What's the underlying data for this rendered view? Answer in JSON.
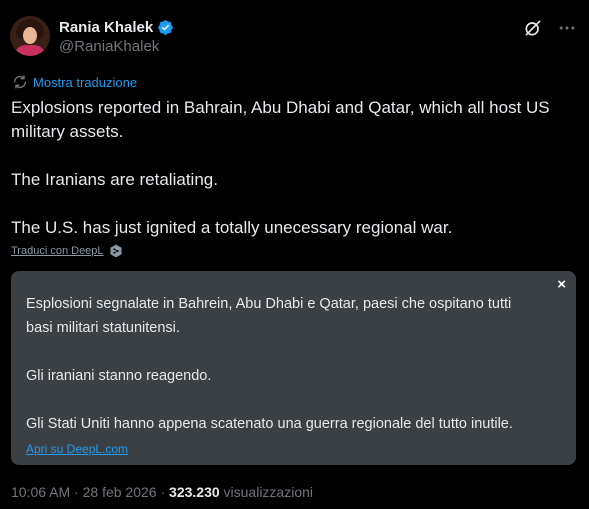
{
  "author": {
    "display_name": "Rania Khalek",
    "handle": "@RaniaKhalek",
    "verified": true,
    "verified_color": "#1d9bf0"
  },
  "translate": {
    "show_translation": "Mostra traduzione",
    "translate_with": "Traduci con DeepL"
  },
  "tweet": {
    "paragraphs": [
      "Explosions reported in Bahrain, Abu Dhabi and Qatar, which all host US military assets.",
      "The Iranians are retaliating.",
      "The U.S. has just ignited a totally unecessary regional war."
    ]
  },
  "deepl_box": {
    "close": "×",
    "paragraphs": [
      "Esplosioni segnalate in Bahrein, Abu Dhabi e Qatar, paesi che ospitano tutti basi militari statunitensi.",
      "Gli iraniani stanno reagendo.",
      "Gli Stati Uniti hanno appena scatenato una guerra regionale del tutto inutile."
    ],
    "open_link": "Apri su DeepL.com"
  },
  "meta": {
    "time": "10:06 AM",
    "separator": " · ",
    "date": "28 feb 2026",
    "views_count": "323.230",
    "views_label": "visualizzazioni"
  },
  "icons": {
    "verified": "verified-badge-icon",
    "grok": "grok-icon",
    "more": "more-options-icon",
    "translate": "translate-icon",
    "deepl": "deepl-logo-icon"
  }
}
